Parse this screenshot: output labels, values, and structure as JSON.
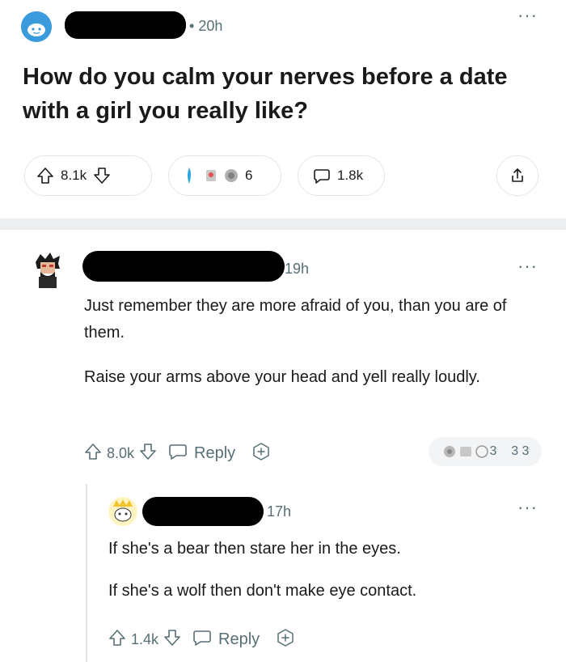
{
  "post": {
    "time": "20h",
    "more": "···",
    "title": "How do you calm your nerves before a date with a girl you really like?",
    "votes": "8.1k",
    "award_count": "6",
    "comments": "1.8k"
  },
  "comment1": {
    "time": "19h",
    "more": "···",
    "paragraphs": [
      "Just remember they are more afraid of you, than you are of them.",
      "Raise your arms above your head and yell really loudly."
    ],
    "votes": "8.0k",
    "reply_label": "Reply",
    "awards_text": "3    3 3"
  },
  "comment2": {
    "time": "17h",
    "more": "···",
    "paragraphs": [
      "If she's a bear then stare her in the eyes.",
      "If she's a wolf then don't make eye contact."
    ],
    "votes": "1.4k",
    "reply_label": "Reply"
  },
  "colors": {
    "text": "#1a1a1b",
    "meta": "#576f76",
    "border": "#e2e6e8",
    "divider": "#eceeef",
    "avatar_blue": "#3a9bdc"
  }
}
